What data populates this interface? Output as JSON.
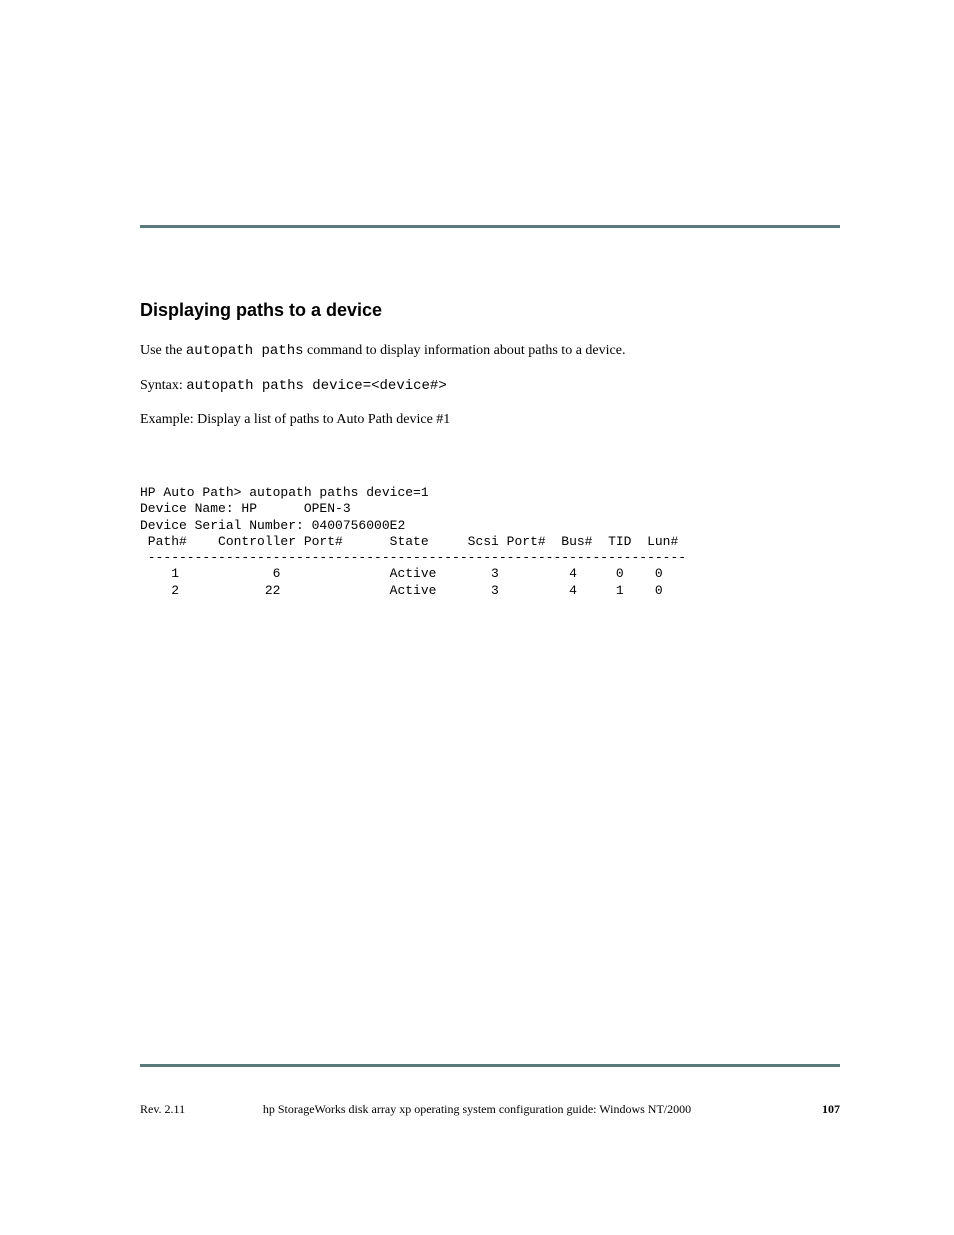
{
  "section": {
    "title": "Displaying paths to a device"
  },
  "body": {
    "p1_prefix": "Use the ",
    "p1_code": "autopath paths",
    "p1_suffix": " command to display information about paths to a device.",
    "p2_label": "Syntax:",
    "p2_code": "autopath paths device=<device#>",
    "p3_label": "Example:",
    "p3_text": "Display a list of paths to Auto Path device #1"
  },
  "console": {
    "text": "HP Auto Path> autopath paths device=1\nDevice Name: HP      OPEN-3\nDevice Serial Number: 0400756000E2\n Path#    Controller Port#      State     Scsi Port#  Bus#  TID  Lun#\n ---------------------------------------------------------------------\n    1            6              Active       3         4     0    0\n    2           22              Active       3         4     1    0"
  },
  "footer": {
    "rev": "Rev. 2.11",
    "title": "hp StorageWorks disk array xp operating system configuration guide: Windows NT/2000",
    "page": "107"
  }
}
